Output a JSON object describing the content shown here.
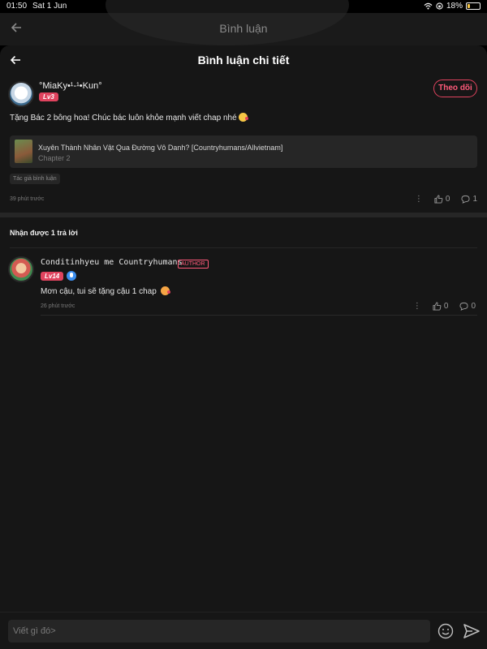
{
  "status_bar": {
    "time": "01:50",
    "date": "Sat 1 Jun",
    "battery": "18%",
    "battery_level": 0.18
  },
  "background_page": {
    "title": "Bình luận"
  },
  "sheet": {
    "title": "Bình luận chi tiết"
  },
  "main_comment": {
    "username": "°MiaKy•¹-¹•Kun°",
    "level": "Lv3",
    "follow_label": "Theo dõi",
    "text": "Tặng Bác 2 bông hoa! Chúc bác luôn khỏe mạnh viết chap nhé",
    "chapter": {
      "title": "Xuyên Thành Nhân Vật Qua Đường Vô Danh? [Countryhumans/Allvietnam]",
      "subtitle": "Chapter 2"
    },
    "tag": "Tác giả bình luận",
    "time": "39 phút trước",
    "likes": "0",
    "replies": "1"
  },
  "replies_header": "Nhận được 1 trả lời",
  "reply": {
    "username": "Conditinhyeu me Countryhumans",
    "author_badge": "AUTHOR",
    "level": "Lv14",
    "text": "Mơn cậu, tui sẽ tặng cậu 1 chap",
    "time": "26 phút trước",
    "likes": "0",
    "replies": "0"
  },
  "input": {
    "placeholder": "Viết gì đó>"
  },
  "colors": {
    "accent": "#e0435e",
    "background": "#161616",
    "card": "#262626"
  }
}
